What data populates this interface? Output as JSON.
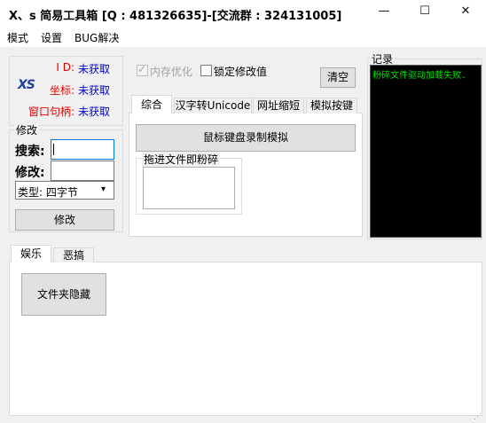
{
  "window": {
    "title": "X、s 简易工具箱 [Q : 481326635]-[交流群 : 324131005]",
    "minimize": "—",
    "maximize": "☐",
    "close": "✕"
  },
  "menu": [
    "模式",
    "设置",
    "BUG解决"
  ],
  "info": {
    "logo_text": "XS",
    "id_label": "I D:",
    "id_value": "未获取",
    "coord_label": "坐标:",
    "coord_value": "未获取",
    "handle_label": "窗口句柄:",
    "handle_value": "未获取"
  },
  "modify": {
    "group_label": "修改",
    "search_label": "搜索:",
    "search_value": "",
    "modify_label": "修改:",
    "modify_value": "",
    "type_select": "类型: 四字节",
    "modify_button": "修改"
  },
  "options": {
    "memory_opt_label": "内存优化",
    "memory_opt_checked": true,
    "memory_opt_disabled": true,
    "lock_label": "锁定修改值",
    "lock_checked": false,
    "clear_button": "清空"
  },
  "tabs_top": {
    "tabs": [
      "综合",
      "汉字转Unicode",
      "网址缩短",
      "模拟按键"
    ],
    "active": 0,
    "record_button": "鼠标键盘录制模拟",
    "shred_group_label": "拖进文件即粉碎"
  },
  "log": {
    "label": "记录",
    "lines": [
      "粉碎文件驱动加载失败."
    ],
    "bg_color": "#000000",
    "text_color": "#00e000"
  },
  "tabs_bottom": {
    "tabs": [
      "娱乐",
      "恶搞"
    ],
    "active": 0,
    "hide_folder_button": "文件夹隐藏"
  },
  "colors": {
    "label_red": "#e60000",
    "value_blue": "#0000cc"
  }
}
